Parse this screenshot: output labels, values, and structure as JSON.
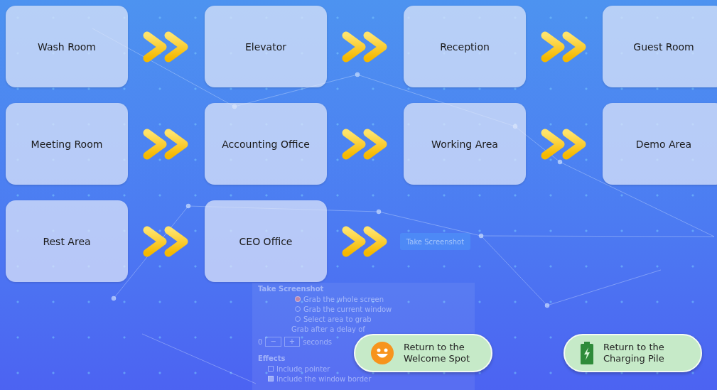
{
  "stations": [
    {
      "label": "Wash Room",
      "arrow_after": true
    },
    {
      "label": "Elevator",
      "arrow_after": true
    },
    {
      "label": "Reception",
      "arrow_after": true
    },
    {
      "label": "Guest Room"
    },
    {
      "label": "Meeting Room",
      "arrow_after": true
    },
    {
      "label": "Accounting Office",
      "arrow_after": true
    },
    {
      "label": "Working Area",
      "arrow_after": true
    },
    {
      "label": "Demo Area"
    },
    {
      "label": "Rest Area",
      "arrow_after": true
    },
    {
      "label": "CEO Office",
      "arrow_after": true
    }
  ],
  "background_dialog": {
    "button": "Take Screenshot",
    "title": "Take Screenshot",
    "options": [
      {
        "label": "Grab the whole screen",
        "selected": true
      },
      {
        "label": "Grab the current window",
        "selected": false
      },
      {
        "label": "Select area to grab",
        "selected": false
      }
    ],
    "delay_label": "Grab after a delay of",
    "delay_value": "0",
    "minus": "−",
    "plus": "+",
    "delay_unit": "seconds",
    "effects_title": "Effects",
    "effects": [
      {
        "label": "Include pointer",
        "checked": false
      },
      {
        "label": "Include the window border",
        "checked": true
      }
    ]
  },
  "actions": [
    {
      "kind": "welcome",
      "label": "Return to the Welcome Spot"
    },
    {
      "kind": "charging",
      "label": "Return to the Charging Pile"
    }
  ]
}
